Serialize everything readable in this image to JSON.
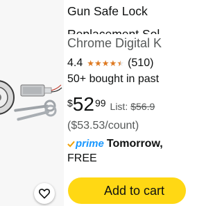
{
  "product": {
    "title_line1": "Gun Safe Lock",
    "title_line2": "Replacement Sol",
    "subtitle": "Chrome Digital K",
    "rating": "4.4",
    "rating_stars": 4.4,
    "review_count": "(510)",
    "bought": "50+ bought in past",
    "price_currency": "$",
    "price_whole": "52",
    "price_fraction": "99",
    "list_label": "List:",
    "list_price": "$56.9",
    "unit_price": "($53.53/count)",
    "prime_label": "prime",
    "delivery_day": "Tomorrow,",
    "delivery_cost": "FREE",
    "add_to_cart": "Add to cart"
  },
  "colors": {
    "star": "#de7921",
    "prime": "#1a98ff",
    "cart_button": "#ffd814",
    "image_bg": "#f7f7f7"
  },
  "icons": {
    "wishlist": "heart-icon",
    "prime": "check-icon"
  }
}
